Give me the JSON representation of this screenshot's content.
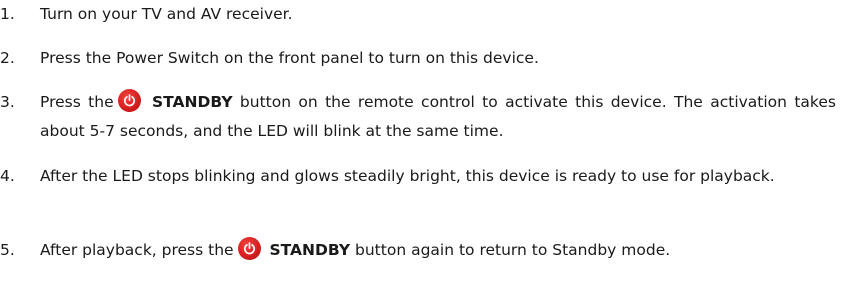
{
  "steps": [
    {
      "number": "1.",
      "text": "Turn on your TV and AV receiver."
    },
    {
      "number": "2.",
      "text": "Press the Power Switch on the front panel to turn on this device."
    },
    {
      "number": "3.",
      "before": "Press the",
      "button_icon": "power-button-icon",
      "bold": "STANDBY",
      "after": "button on the remote control to activate this device. The activation takes about 5-7 seconds, and the LED will blink at the same time."
    },
    {
      "number": "4.",
      "text": "After the LED stops blinking and glows steadily bright, this device is ready to use for playback."
    },
    {
      "number": "5.",
      "before": "After playback, press the",
      "button_icon": "power-button-icon",
      "bold": "STANDBY",
      "after": "button again to return to Standby mode."
    }
  ],
  "colors": {
    "text": "#1a1a1a",
    "button_red": "#d81f1f"
  }
}
